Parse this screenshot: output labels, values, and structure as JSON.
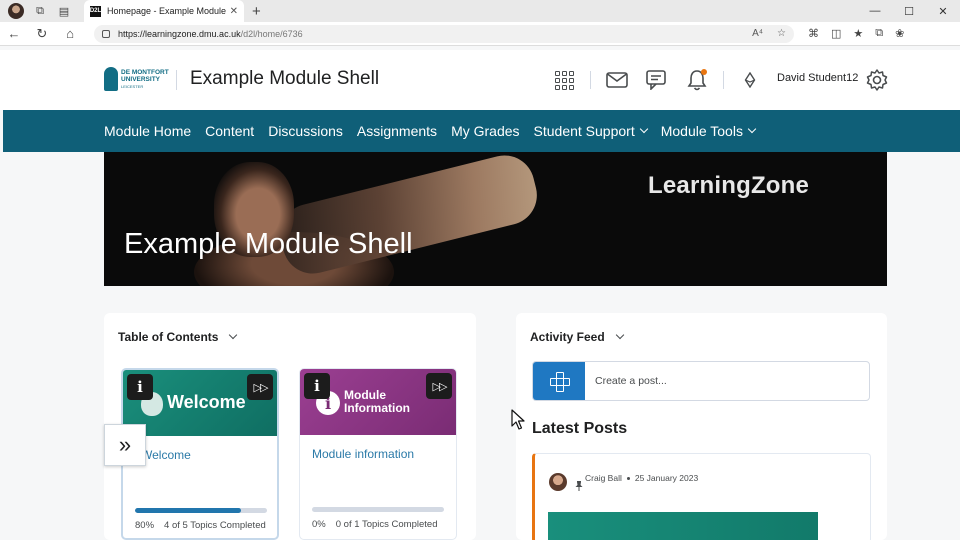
{
  "browser": {
    "tab_title": "Homepage - Example Module Sh",
    "tab_favicon": "D2L",
    "url_host": "https://learningzone.dmu.ac.uk",
    "url_path": "/d2l/home/6736"
  },
  "header": {
    "logo_line1": "DE MONTFORT",
    "logo_line2": "UNIVERSITY",
    "logo_line3": "LEICESTER",
    "title": "Example Module Shell",
    "user_name": "David Student12",
    "icons": [
      "waffle-icon",
      "mail-icon",
      "chat-icon",
      "bell-icon",
      "role-icon",
      "gear-icon"
    ],
    "notification_color": "#e87511"
  },
  "nav": {
    "items": [
      {
        "label": "Module Home",
        "dropdown": false
      },
      {
        "label": "Content",
        "dropdown": false
      },
      {
        "label": "Discussions",
        "dropdown": false
      },
      {
        "label": "Assignments",
        "dropdown": false
      },
      {
        "label": "My Grades",
        "dropdown": false
      },
      {
        "label": "Student Support",
        "dropdown": true
      },
      {
        "label": "Module Tools",
        "dropdown": true
      }
    ],
    "color": "#0f5f78"
  },
  "banner": {
    "brand": "LearningZone",
    "title": "Example Module Shell"
  },
  "toc": {
    "heading": "Table of Contents",
    "tiles": [
      {
        "art_title": "Welcome",
        "link": "Welcome",
        "percent_label": "80%",
        "progress": 0.8,
        "completed_label": "4 of 5 Topics Completed"
      },
      {
        "art_title_line1": "Module",
        "art_title_line2": "Information",
        "link": "Module information",
        "percent_label": "0%",
        "progress": 0,
        "completed_label": "0 of 1 Topics Completed"
      }
    ]
  },
  "activity": {
    "heading": "Activity Feed",
    "post_placeholder": "Create a post...",
    "latest_heading": "Latest Posts",
    "post": {
      "author": "Craig Ball",
      "date": "25 January 2023"
    }
  }
}
